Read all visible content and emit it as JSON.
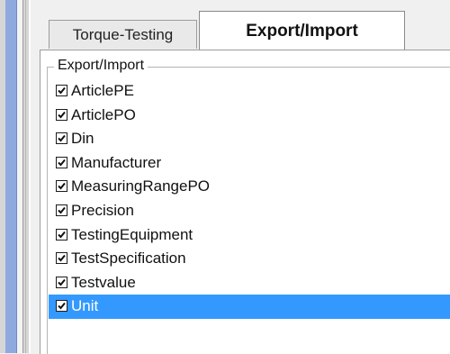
{
  "tabs": [
    {
      "label": "Torque-Testing",
      "active": false
    },
    {
      "label": "Export/Import",
      "active": true
    }
  ],
  "group": {
    "title": "Export/Import",
    "items": [
      {
        "label": "ArticlePE",
        "checked": true
      },
      {
        "label": "ArticlePO",
        "checked": true
      },
      {
        "label": "Din",
        "checked": true
      },
      {
        "label": "Manufacturer",
        "checked": true
      },
      {
        "label": "MeasuringRangePO",
        "checked": true
      },
      {
        "label": "Precision",
        "checked": true
      },
      {
        "label": "TestingEquipment",
        "checked": true
      },
      {
        "label": "TestSpecification",
        "checked": true
      },
      {
        "label": "Testvalue",
        "checked": true
      },
      {
        "label": "Unit",
        "checked": true,
        "selected": true
      }
    ]
  },
  "colors": {
    "selection": "#3399ff",
    "window_accent": "#8fa9de"
  }
}
